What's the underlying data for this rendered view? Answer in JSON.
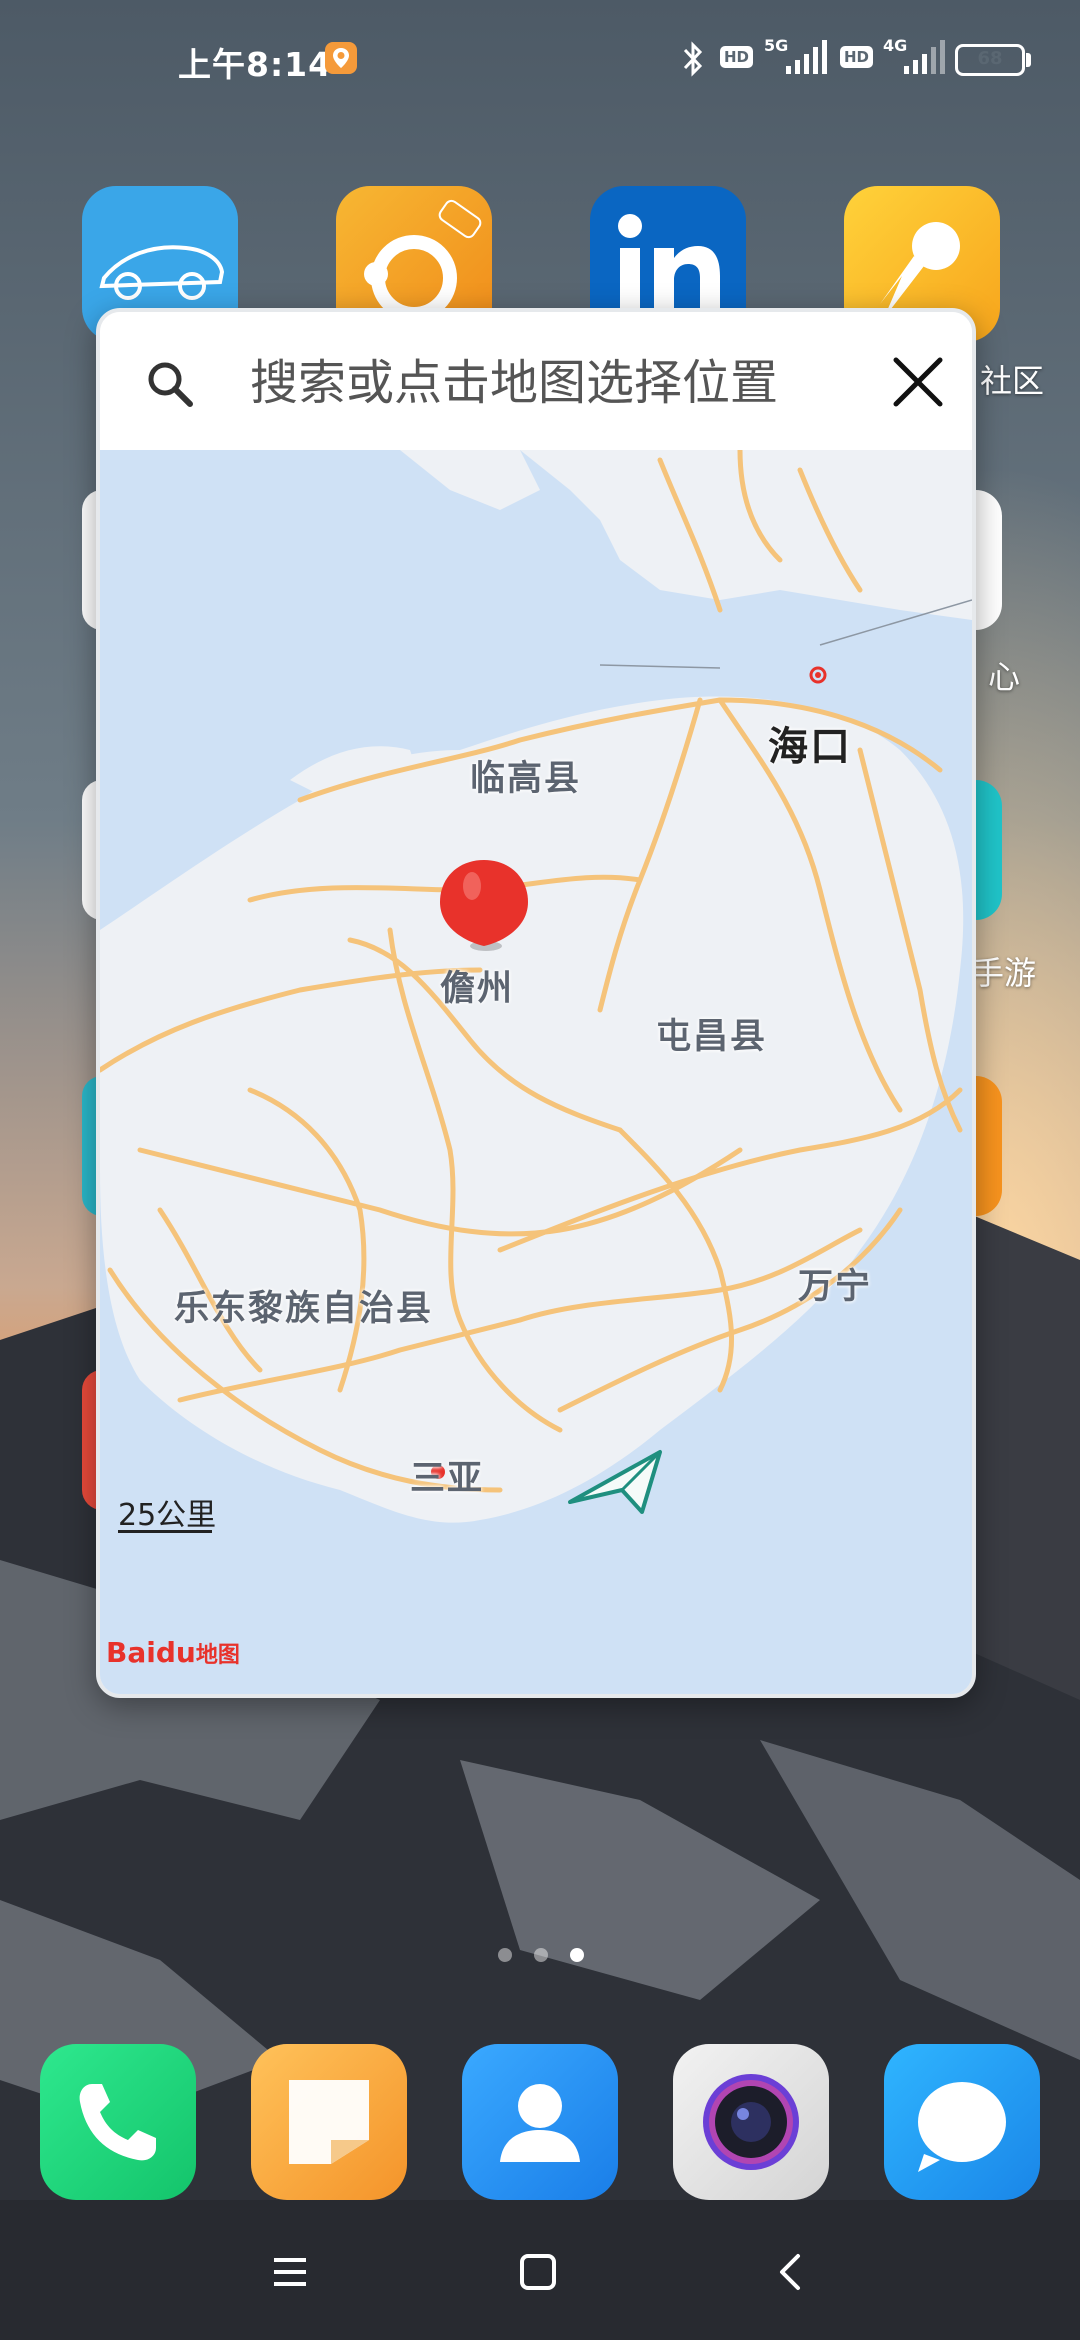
{
  "status_bar": {
    "time": "上午8:14",
    "net1": "5G",
    "net2": "4G",
    "hd": "HD",
    "battery": "68",
    "battery_level": 0.68
  },
  "home": {
    "labels": [
      "社区",
      "心",
      "手游"
    ]
  },
  "picker": {
    "search_placeholder": "搜索或点击地图选择位置",
    "cities": [
      "海口",
      "临高县",
      "儋州",
      "屯昌县",
      "乐东黎族自治县",
      "万宁",
      "三亚"
    ],
    "scale": "25公里",
    "logo_brand": "Baidu",
    "logo_suffix": "地图"
  },
  "colors": {
    "road": "#f5c37a",
    "land": "#eef1f5",
    "sea": "#cfe1f5",
    "marker": "#e8322b"
  }
}
